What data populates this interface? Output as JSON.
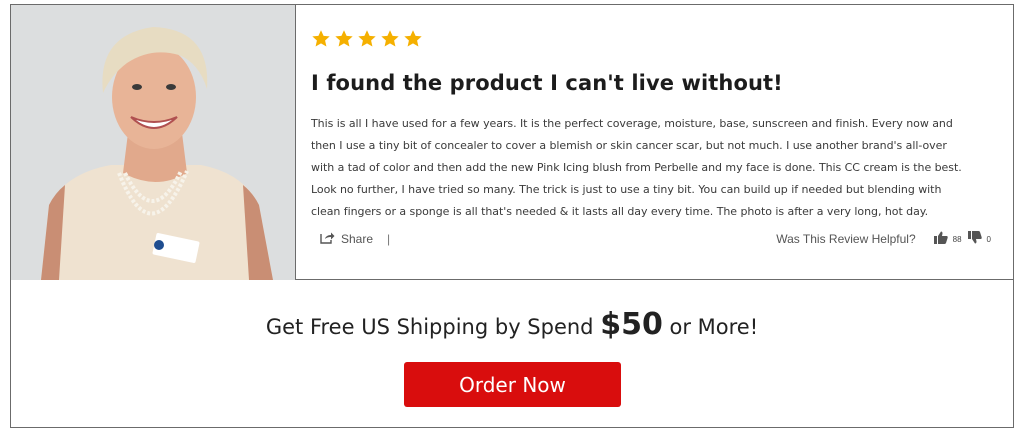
{
  "review": {
    "rating": 5,
    "rating_max": 5,
    "star_color": "#f5b000",
    "title": "I found the product I can't live without!",
    "body": "This is all I have used for a few years. It is the perfect coverage, moisture, base, sunscreen and finish. Every now and then I use a tiny bit of concealer to cover a blemish or skin cancer scar, but not much. I use another brand's all-over with a tad of color and then add the new Pink Icing blush from Perbelle and my face is done. This CC cream is the best. Look no further, I have tried so many. The trick is just to use a tiny bit. You can build up if needed but blending with clean fingers or a sponge is all that's needed & it lasts all day every time. The photo is after a very long, hot day."
  },
  "actions": {
    "share_label": "Share",
    "separator": "|",
    "helpful_label": "Was This Review Helpful?",
    "upvotes": "88",
    "downvotes": "0"
  },
  "promo": {
    "text_before": "Get Free US Shipping by Spend ",
    "amount": "$50",
    "text_after": " or More!",
    "button_label": "Order Now",
    "button_color": "#d90d0d"
  },
  "icons": {
    "star": "star-icon",
    "share": "share-icon",
    "thumbs_up": "thumbs-up-icon",
    "thumbs_down": "thumbs-down-icon"
  }
}
